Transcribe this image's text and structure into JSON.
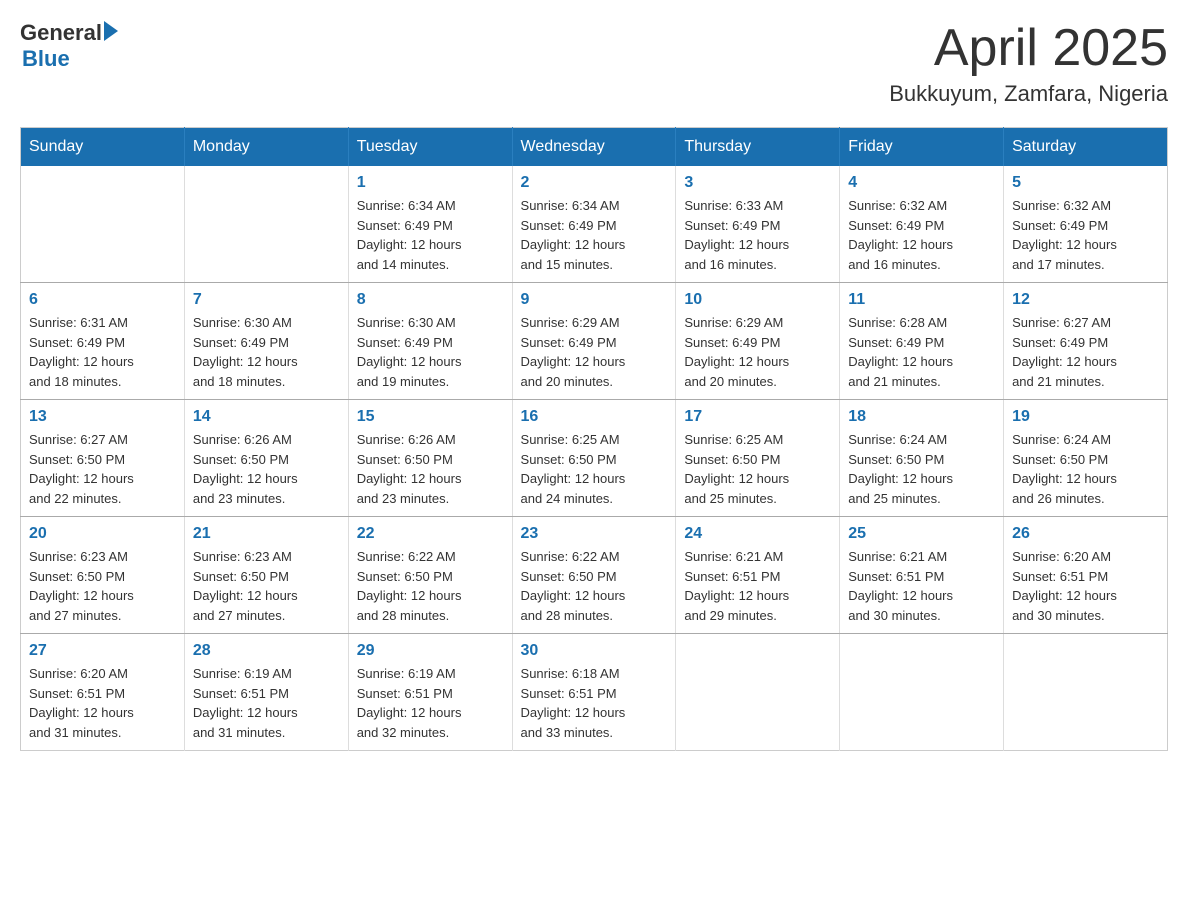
{
  "header": {
    "logo_general": "General",
    "logo_blue": "Blue",
    "month_title": "April 2025",
    "location": "Bukkuyum, Zamfara, Nigeria"
  },
  "weekdays": [
    "Sunday",
    "Monday",
    "Tuesday",
    "Wednesday",
    "Thursday",
    "Friday",
    "Saturday"
  ],
  "weeks": [
    [
      {
        "day": "",
        "info": ""
      },
      {
        "day": "",
        "info": ""
      },
      {
        "day": "1",
        "info": "Sunrise: 6:34 AM\nSunset: 6:49 PM\nDaylight: 12 hours\nand 14 minutes."
      },
      {
        "day": "2",
        "info": "Sunrise: 6:34 AM\nSunset: 6:49 PM\nDaylight: 12 hours\nand 15 minutes."
      },
      {
        "day": "3",
        "info": "Sunrise: 6:33 AM\nSunset: 6:49 PM\nDaylight: 12 hours\nand 16 minutes."
      },
      {
        "day": "4",
        "info": "Sunrise: 6:32 AM\nSunset: 6:49 PM\nDaylight: 12 hours\nand 16 minutes."
      },
      {
        "day": "5",
        "info": "Sunrise: 6:32 AM\nSunset: 6:49 PM\nDaylight: 12 hours\nand 17 minutes."
      }
    ],
    [
      {
        "day": "6",
        "info": "Sunrise: 6:31 AM\nSunset: 6:49 PM\nDaylight: 12 hours\nand 18 minutes."
      },
      {
        "day": "7",
        "info": "Sunrise: 6:30 AM\nSunset: 6:49 PM\nDaylight: 12 hours\nand 18 minutes."
      },
      {
        "day": "8",
        "info": "Sunrise: 6:30 AM\nSunset: 6:49 PM\nDaylight: 12 hours\nand 19 minutes."
      },
      {
        "day": "9",
        "info": "Sunrise: 6:29 AM\nSunset: 6:49 PM\nDaylight: 12 hours\nand 20 minutes."
      },
      {
        "day": "10",
        "info": "Sunrise: 6:29 AM\nSunset: 6:49 PM\nDaylight: 12 hours\nand 20 minutes."
      },
      {
        "day": "11",
        "info": "Sunrise: 6:28 AM\nSunset: 6:49 PM\nDaylight: 12 hours\nand 21 minutes."
      },
      {
        "day": "12",
        "info": "Sunrise: 6:27 AM\nSunset: 6:49 PM\nDaylight: 12 hours\nand 21 minutes."
      }
    ],
    [
      {
        "day": "13",
        "info": "Sunrise: 6:27 AM\nSunset: 6:50 PM\nDaylight: 12 hours\nand 22 minutes."
      },
      {
        "day": "14",
        "info": "Sunrise: 6:26 AM\nSunset: 6:50 PM\nDaylight: 12 hours\nand 23 minutes."
      },
      {
        "day": "15",
        "info": "Sunrise: 6:26 AM\nSunset: 6:50 PM\nDaylight: 12 hours\nand 23 minutes."
      },
      {
        "day": "16",
        "info": "Sunrise: 6:25 AM\nSunset: 6:50 PM\nDaylight: 12 hours\nand 24 minutes."
      },
      {
        "day": "17",
        "info": "Sunrise: 6:25 AM\nSunset: 6:50 PM\nDaylight: 12 hours\nand 25 minutes."
      },
      {
        "day": "18",
        "info": "Sunrise: 6:24 AM\nSunset: 6:50 PM\nDaylight: 12 hours\nand 25 minutes."
      },
      {
        "day": "19",
        "info": "Sunrise: 6:24 AM\nSunset: 6:50 PM\nDaylight: 12 hours\nand 26 minutes."
      }
    ],
    [
      {
        "day": "20",
        "info": "Sunrise: 6:23 AM\nSunset: 6:50 PM\nDaylight: 12 hours\nand 27 minutes."
      },
      {
        "day": "21",
        "info": "Sunrise: 6:23 AM\nSunset: 6:50 PM\nDaylight: 12 hours\nand 27 minutes."
      },
      {
        "day": "22",
        "info": "Sunrise: 6:22 AM\nSunset: 6:50 PM\nDaylight: 12 hours\nand 28 minutes."
      },
      {
        "day": "23",
        "info": "Sunrise: 6:22 AM\nSunset: 6:50 PM\nDaylight: 12 hours\nand 28 minutes."
      },
      {
        "day": "24",
        "info": "Sunrise: 6:21 AM\nSunset: 6:51 PM\nDaylight: 12 hours\nand 29 minutes."
      },
      {
        "day": "25",
        "info": "Sunrise: 6:21 AM\nSunset: 6:51 PM\nDaylight: 12 hours\nand 30 minutes."
      },
      {
        "day": "26",
        "info": "Sunrise: 6:20 AM\nSunset: 6:51 PM\nDaylight: 12 hours\nand 30 minutes."
      }
    ],
    [
      {
        "day": "27",
        "info": "Sunrise: 6:20 AM\nSunset: 6:51 PM\nDaylight: 12 hours\nand 31 minutes."
      },
      {
        "day": "28",
        "info": "Sunrise: 6:19 AM\nSunset: 6:51 PM\nDaylight: 12 hours\nand 31 minutes."
      },
      {
        "day": "29",
        "info": "Sunrise: 6:19 AM\nSunset: 6:51 PM\nDaylight: 12 hours\nand 32 minutes."
      },
      {
        "day": "30",
        "info": "Sunrise: 6:18 AM\nSunset: 6:51 PM\nDaylight: 12 hours\nand 33 minutes."
      },
      {
        "day": "",
        "info": ""
      },
      {
        "day": "",
        "info": ""
      },
      {
        "day": "",
        "info": ""
      }
    ]
  ]
}
